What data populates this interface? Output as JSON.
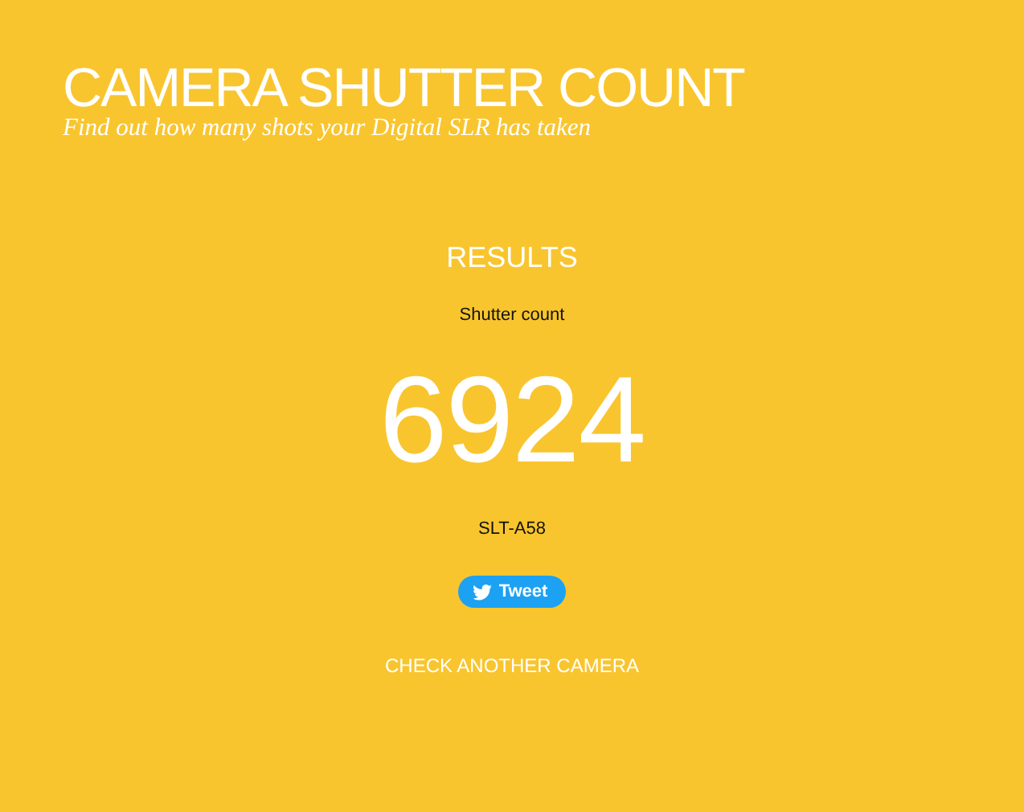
{
  "header": {
    "title": "CAMERA SHUTTER COUNT",
    "subtitle": "Find out how many shots your Digital SLR has taken"
  },
  "results": {
    "heading": "RESULTS",
    "label": "Shutter count",
    "count": "6924",
    "model": "SLT-A58"
  },
  "tweet_button": {
    "label": "Tweet"
  },
  "link": "CHECK ANOTHER CAMERA"
}
